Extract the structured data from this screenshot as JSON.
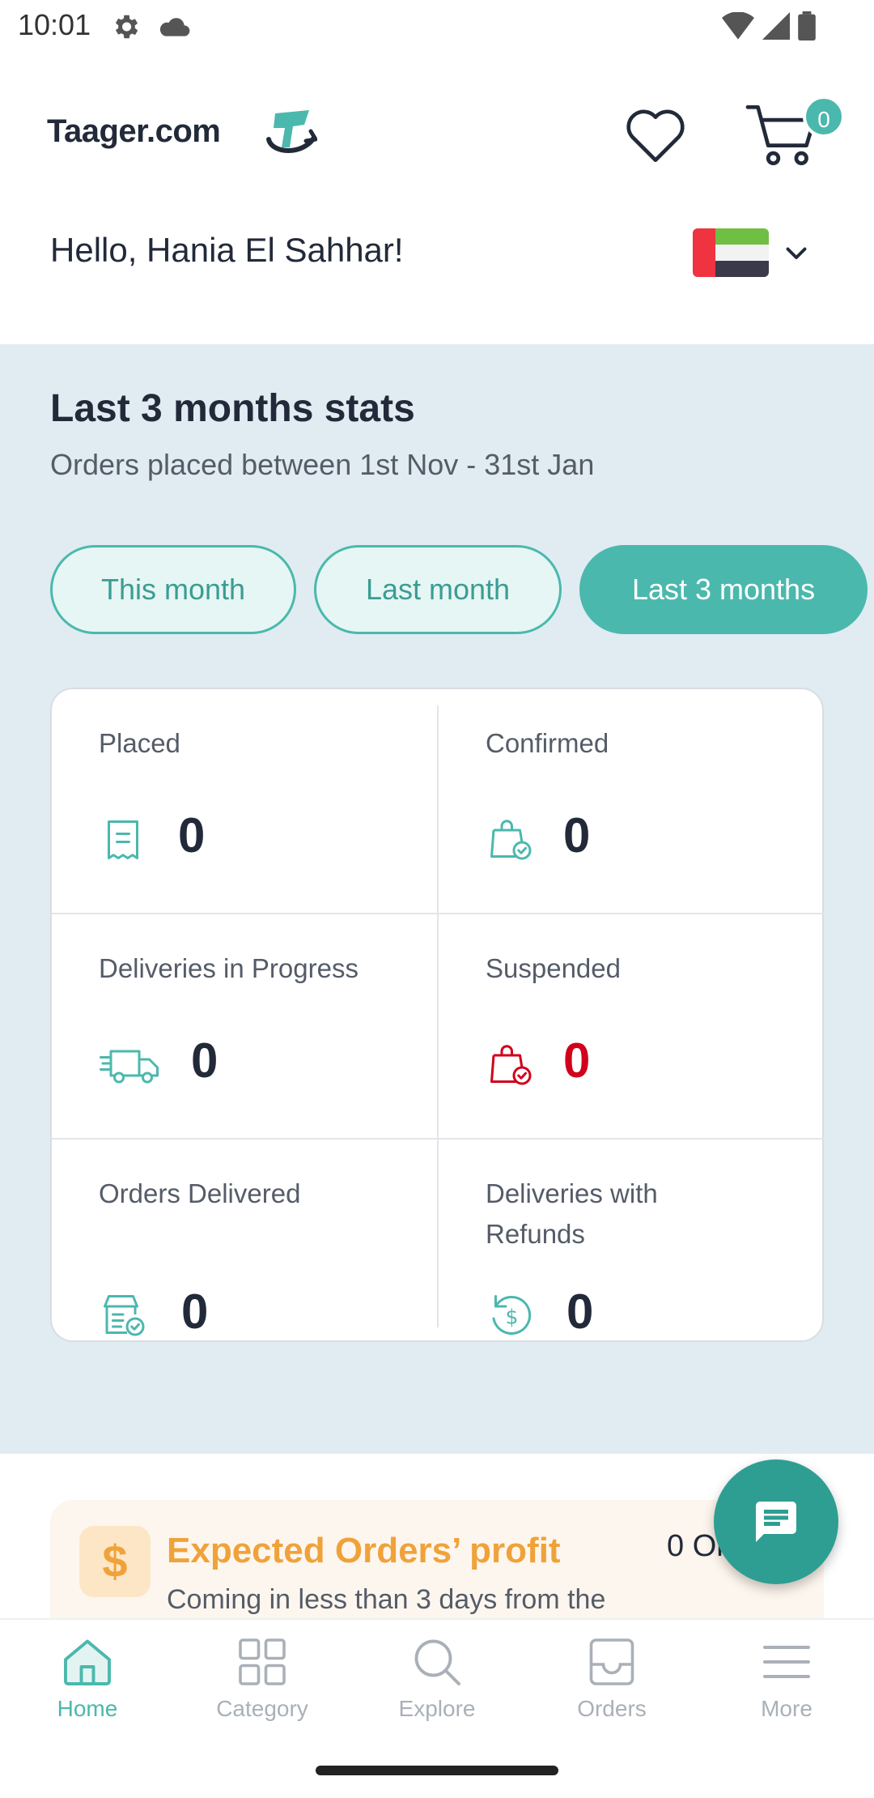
{
  "status_bar": {
    "time": "10:01"
  },
  "header": {
    "brand": "Taager.com",
    "cart_count": "0"
  },
  "greeting": "Hello, Hania El Sahhar!",
  "stats": {
    "title": "Last 3 months stats",
    "subtitle": "Orders placed between 1st Nov - 31st Jan",
    "filters": [
      "This month",
      "Last month",
      "Last 3 months"
    ],
    "selected_filter": "Last 3 months",
    "cells": [
      {
        "label": "Placed",
        "value": "0"
      },
      {
        "label": "Confirmed",
        "value": "0"
      },
      {
        "label": "Deliveries in Progress",
        "value": "0"
      },
      {
        "label": "Suspended",
        "value": "0"
      },
      {
        "label": "Orders Delivered",
        "value": "0"
      },
      {
        "label": "Deliveries with Refunds",
        "value": "0"
      }
    ]
  },
  "profit": {
    "icon": "$",
    "title": "Expected Orders’ profit",
    "value": "0 Or",
    "subtitle": "Coming in less than 3 days from the"
  },
  "nav": {
    "items": [
      {
        "label": "Home",
        "icon": "home-icon"
      },
      {
        "label": "Category",
        "icon": "grid-icon"
      },
      {
        "label": "Explore",
        "icon": "search-icon"
      },
      {
        "label": "Orders",
        "icon": "box-icon"
      },
      {
        "label": "More",
        "icon": "menu-icon"
      }
    ],
    "active": "Home"
  },
  "colors": {
    "accent": "#4bb8ad",
    "accent_dark": "#2e9e92",
    "stats_background": "#e0ecf2",
    "alert_red": "#d0021b",
    "profit_orange": "#f0a23a"
  }
}
